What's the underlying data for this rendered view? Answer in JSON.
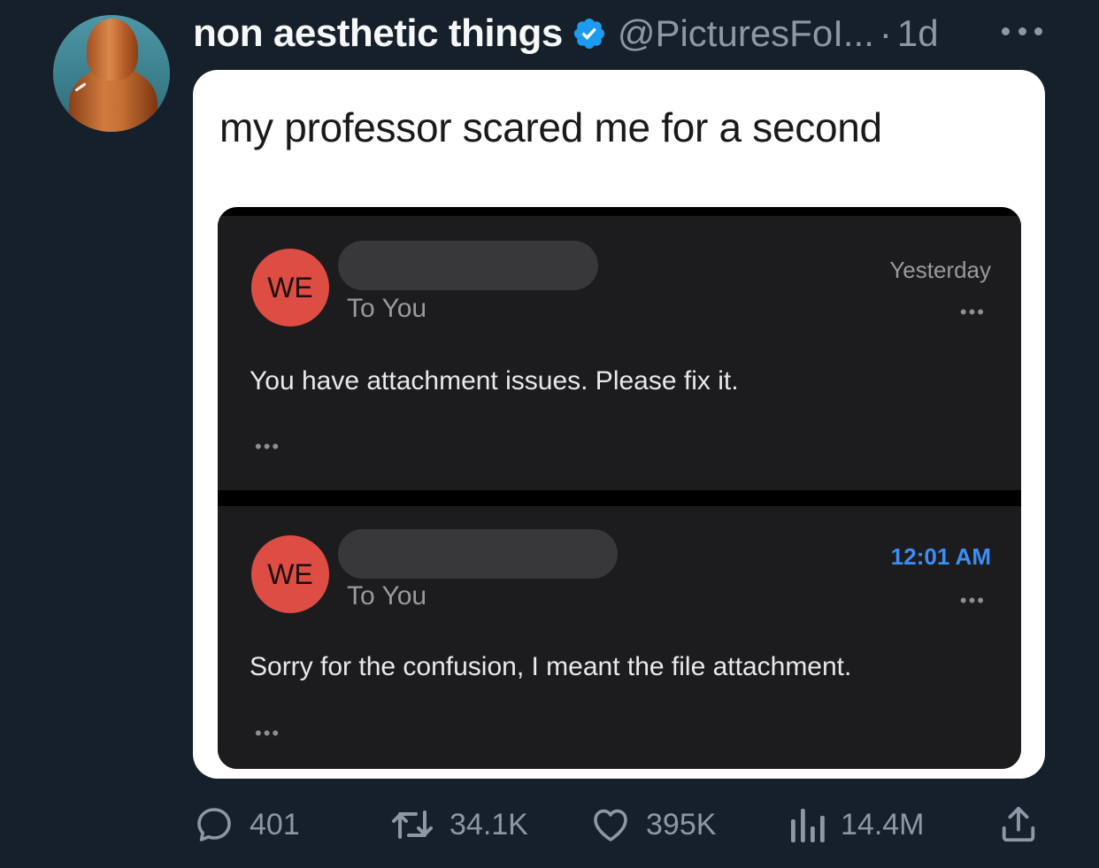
{
  "tweet": {
    "display_name": "non aesthetic things",
    "handle": "@PicturesFoI...",
    "separator": "·",
    "time": "1d",
    "caption": "my professor scared me for a second"
  },
  "emails": [
    {
      "initials": "WE",
      "to": "To You",
      "timestamp": "Yesterday",
      "timestamp_color": "#9a9a9e",
      "more": "•••",
      "body": "You have attachment issues. Please fix it.",
      "body_more": "•••"
    },
    {
      "initials": "WE",
      "to": "To You",
      "timestamp": "12:01 AM",
      "timestamp_color": "#3a8ef6",
      "more": "•••",
      "body": "Sorry for the confusion, I meant the file attachment.",
      "body_more": "•••"
    }
  ],
  "actions": {
    "replies": "401",
    "retweets": "34.1K",
    "likes": "395K",
    "views": "14.4M"
  },
  "icons": {
    "verified": "verified-badge-icon",
    "more": "more-horizontal-icon",
    "reply": "reply-icon",
    "retweet": "retweet-icon",
    "like": "heart-icon",
    "views": "views-chart-icon",
    "share": "share-icon"
  },
  "colors": {
    "background": "#15202b",
    "verified": "#1d9bf0",
    "avatar_badge": "#dd4d44",
    "muted": "#8b98a5"
  }
}
